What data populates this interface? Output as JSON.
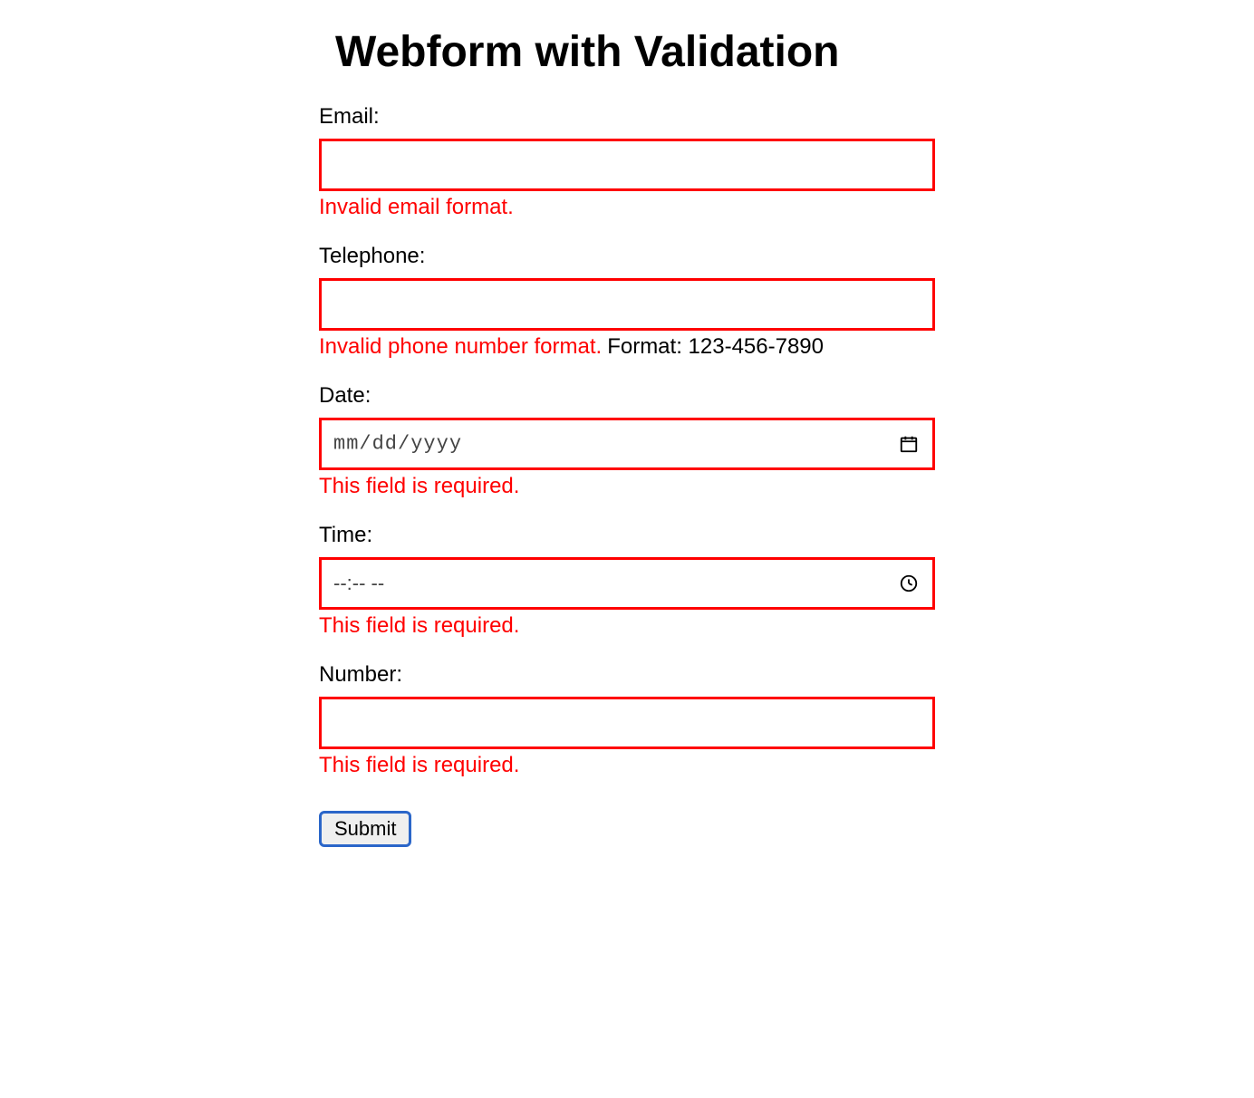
{
  "title": "Webform with Validation",
  "email": {
    "label": "Email:",
    "value": "",
    "error": "Invalid email format."
  },
  "telephone": {
    "label": "Telephone:",
    "value": "",
    "error": "Invalid phone number format.",
    "hint": "Format: 123-456-7890"
  },
  "date": {
    "label": "Date:",
    "value": "",
    "placeholder": "mm/dd/yyyy",
    "error": "This field is required."
  },
  "time": {
    "label": "Time:",
    "value": "",
    "placeholder": "--:--  --",
    "error": "This field is required."
  },
  "number": {
    "label": "Number:",
    "value": "",
    "error": "This field is required."
  },
  "submit_label": "Submit"
}
